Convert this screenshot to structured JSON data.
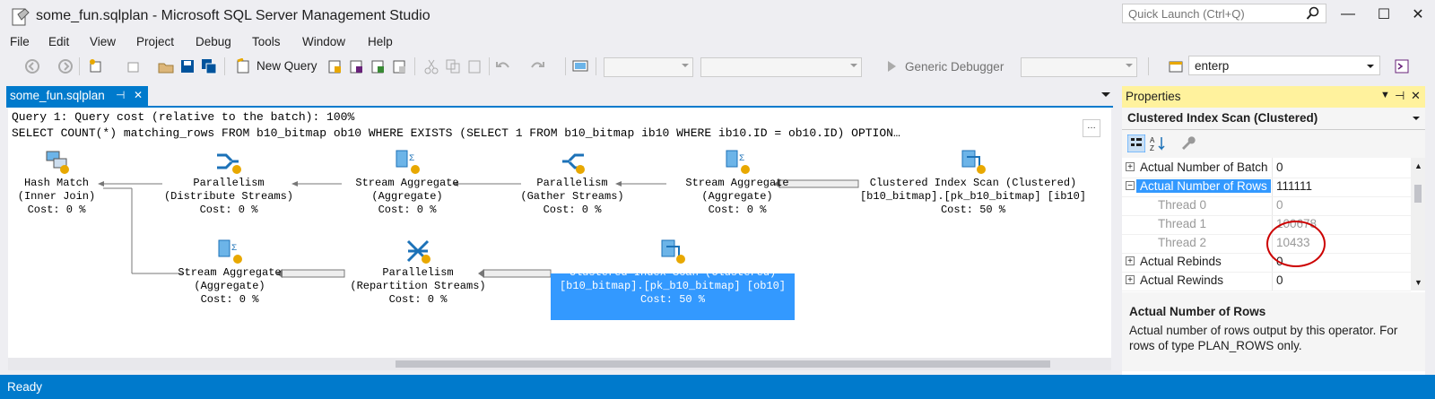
{
  "window": {
    "title": "some_fun.sqlplan - Microsoft SQL Server Management Studio",
    "quick_launch_placeholder": "Quick Launch (Ctrl+Q)"
  },
  "menu": [
    "File",
    "Edit",
    "View",
    "Project",
    "Debug",
    "Tools",
    "Window",
    "Help"
  ],
  "toolbar": {
    "new_query": "New Query",
    "debugger": "Generic Debugger",
    "database": "enterp"
  },
  "document_tab": {
    "label": "some_fun.sqlplan",
    "pin": "⊣",
    "close": "✕"
  },
  "plan": {
    "query_line": "Query 1: Query cost (relative to the batch): 100%",
    "sql_line": "SELECT COUNT(*) matching_rows FROM b10_bitmap ob10 WHERE EXISTS (SELECT 1 FROM b10_bitmap ib10 WHERE ib10.ID = ob10.ID) OPTION…",
    "nodes": [
      {
        "l1": "Hash Match",
        "l2": "(Inner Join)",
        "l3": "Cost: 0 %"
      },
      {
        "l1": "Parallelism",
        "l2": "(Distribute Streams)",
        "l3": "Cost: 0 %"
      },
      {
        "l1": "Stream Aggregate",
        "l2": "(Aggregate)",
        "l3": "Cost: 0 %"
      },
      {
        "l1": "Parallelism",
        "l2": "(Gather Streams)",
        "l3": "Cost: 0 %"
      },
      {
        "l1": "Stream Aggregate",
        "l2": "(Aggregate)",
        "l3": "Cost: 0 %"
      },
      {
        "l1": "Clustered Index Scan (Clustered)",
        "l2": "[b10_bitmap].[pk_b10_bitmap] [ib10]",
        "l3": "Cost: 50 %"
      },
      {
        "l1": "Stream Aggregate",
        "l2": "(Aggregate)",
        "l3": "Cost: 0 %"
      },
      {
        "l1": "Parallelism",
        "l2": "(Repartition Streams)",
        "l3": "Cost: 0 %"
      },
      {
        "l1": "Clustered Index Scan (Clustered)",
        "l2": "[b10_bitmap].[pk_b10_bitmap] [ob10]",
        "l3": "Cost: 50 %"
      }
    ]
  },
  "properties": {
    "title": "Properties",
    "object": "Clustered Index Scan (Clustered)",
    "rows": [
      {
        "name": "Actual Number of Batch",
        "value": "0",
        "exp": "+"
      },
      {
        "name": "Actual Number of Rows",
        "value": "111111",
        "exp": "−"
      },
      {
        "name": "Thread 0",
        "value": "0"
      },
      {
        "name": "Thread 1",
        "value": "100678"
      },
      {
        "name": "Thread 2",
        "value": "10433"
      },
      {
        "name": "Actual Rebinds",
        "value": "0",
        "exp": "+"
      },
      {
        "name": "Actual Rewinds",
        "value": "0",
        "exp": "+"
      }
    ],
    "desc_title": "Actual Number of Rows",
    "desc_text": "Actual number of rows output by this operator. For rows of type PLAN_ROWS only."
  },
  "status": "Ready",
  "colors": {
    "accent": "#007acc",
    "selection": "#3399ff",
    "annotation": "#cc0000"
  }
}
